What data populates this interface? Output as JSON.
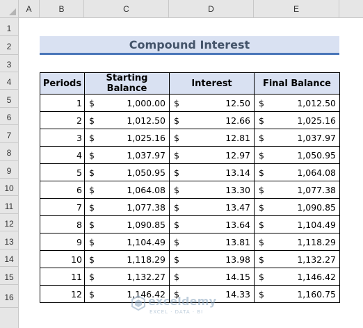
{
  "columns": [
    "A",
    "B",
    "C",
    "D",
    "E"
  ],
  "rows": [
    "1",
    "2",
    "3",
    "4",
    "5",
    "6",
    "7",
    "8",
    "9",
    "10",
    "11",
    "12",
    "13",
    "14",
    "15",
    "16"
  ],
  "title": "Compound Interest",
  "table": {
    "headers": [
      "Periods",
      "Starting Balance",
      "Interest",
      "Final Balance"
    ],
    "currency": "$",
    "rows": [
      {
        "period": "1",
        "start": "1,000.00",
        "interest": "12.50",
        "final": "1,012.50"
      },
      {
        "period": "2",
        "start": "1,012.50",
        "interest": "12.66",
        "final": "1,025.16"
      },
      {
        "period": "3",
        "start": "1,025.16",
        "interest": "12.81",
        "final": "1,037.97"
      },
      {
        "period": "4",
        "start": "1,037.97",
        "interest": "12.97",
        "final": "1,050.95"
      },
      {
        "period": "5",
        "start": "1,050.95",
        "interest": "13.14",
        "final": "1,064.08"
      },
      {
        "period": "6",
        "start": "1,064.08",
        "interest": "13.30",
        "final": "1,077.38"
      },
      {
        "period": "7",
        "start": "1,077.38",
        "interest": "13.47",
        "final": "1,090.85"
      },
      {
        "period": "8",
        "start": "1,090.85",
        "interest": "13.64",
        "final": "1,104.49"
      },
      {
        "period": "9",
        "start": "1,104.49",
        "interest": "13.81",
        "final": "1,118.29"
      },
      {
        "period": "10",
        "start": "1,118.29",
        "interest": "13.98",
        "final": "1,132.27"
      },
      {
        "period": "11",
        "start": "1,132.27",
        "interest": "14.15",
        "final": "1,146.42"
      },
      {
        "period": "12",
        "start": "1,146.42",
        "interest": "14.33",
        "final": "1,160.75"
      }
    ]
  },
  "watermark": {
    "name": "exceldemy",
    "tagline": "EXCEL · DATA · BI"
  },
  "colors": {
    "header_fill": "#d9e1f2",
    "title_text": "#44546a",
    "title_border": "#4a76b9"
  }
}
